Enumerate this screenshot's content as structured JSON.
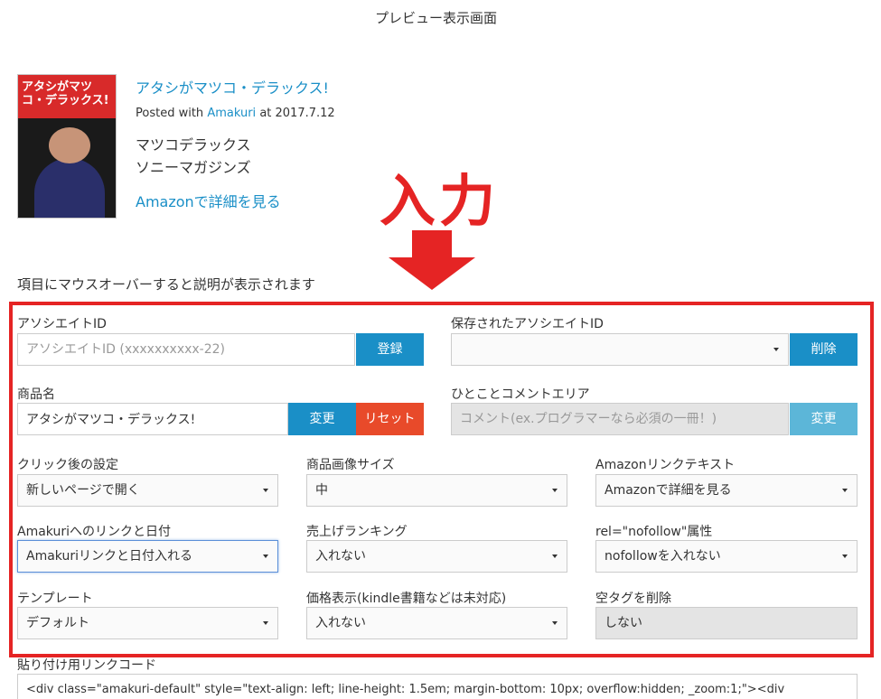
{
  "preview": {
    "title": "プレビュー表示画面",
    "book": {
      "cover_text": "アタシがマツコ・デラックス!",
      "title": "アタシがマツコ・デラックス!",
      "posted_prefix": "Posted with",
      "posted_service": "Amakuri",
      "posted_suffix": "at 2017.7.12",
      "author": "マツコデラックス",
      "publisher": "ソニーマガジンズ",
      "amazon_link": "Amazonで詳細を見る"
    }
  },
  "annotation": {
    "text": "入力",
    "color": "#e52424"
  },
  "hint": "項目にマウスオーバーすると説明が表示されます",
  "form": {
    "associate_id": {
      "label": "アソシエイトID",
      "placeholder": "アソシエイトID (xxxxxxxxxx-22)",
      "value": "",
      "button": "登録"
    },
    "saved_associate": {
      "label": "保存されたアソシエイトID",
      "value": "",
      "button": "削除"
    },
    "product_name": {
      "label": "商品名",
      "value": "アタシがマツコ・デラックス!",
      "change_button": "変更",
      "reset_button": "リセット"
    },
    "comment": {
      "label": "ひとことコメントエリア",
      "placeholder": "コメント(ex.プログラマーなら必須の一冊！)",
      "button": "変更"
    },
    "click_setting": {
      "label": "クリック後の設定",
      "value": "新しいページで開く"
    },
    "image_size": {
      "label": "商品画像サイズ",
      "value": "中"
    },
    "amazon_link_text": {
      "label": "Amazonリンクテキスト",
      "value": "Amazonで詳細を見る"
    },
    "amakuri_link": {
      "label": "Amakuriへのリンクと日付",
      "value": "Amakuriリンクと日付入れる"
    },
    "sales_ranking": {
      "label": "売上げランキング",
      "value": "入れない"
    },
    "nofollow": {
      "label": "rel=\"nofollow\"属性",
      "value": "nofollowを入れない"
    },
    "template": {
      "label": "テンプレート",
      "value": "デフォルト"
    },
    "price": {
      "label": "価格表示(kindle書籍などは未対応)",
      "value": "入れない"
    },
    "empty_tags": {
      "label": "空タグを削除",
      "value": "しない"
    }
  },
  "code": {
    "label": "貼り付け用リンクコード",
    "value": "<div class=\"amakuri-default\" style=\"text-align: left; line-height: 1.5em; margin-bottom: 10px; overflow:hidden; _zoom:1;\"><div"
  },
  "colors": {
    "link": "#1a8fc7",
    "primary_button": "#1a8fc7",
    "reset_button": "#e84a2a",
    "annotation_red": "#e52424"
  }
}
